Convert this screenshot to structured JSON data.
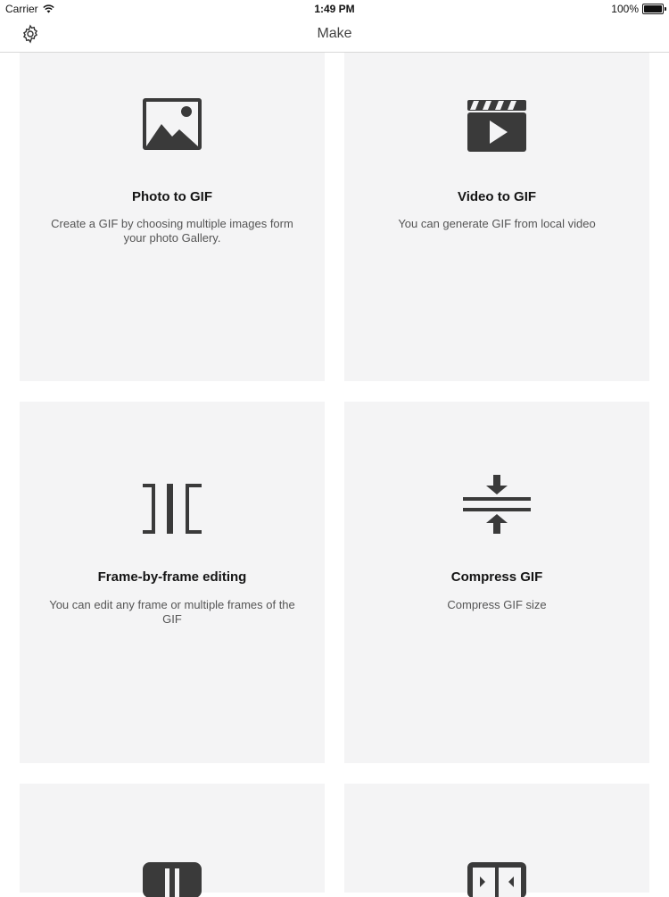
{
  "status_bar": {
    "carrier": "Carrier",
    "time": "1:49 PM",
    "battery": "100%",
    "wifi_icon": "wifi-icon",
    "battery_icon": "battery-icon"
  },
  "nav": {
    "title": "Make",
    "settings_icon": "gear-icon"
  },
  "cards": [
    {
      "icon": "photo-icon",
      "title": "Photo to GIF",
      "description": "Create a GIF by choosing multiple images form your photo Gallery."
    },
    {
      "icon": "video-clapper-icon",
      "title": "Video to GIF",
      "description": "You can generate GIF from local video"
    },
    {
      "icon": "frame-editing-icon",
      "title": "Frame-by-frame editing",
      "description": "You can edit any frame or multiple frames of the GIF"
    },
    {
      "icon": "compress-icon",
      "title": "Compress GIF",
      "description": "Compress GIF size"
    },
    {
      "icon": "columns-icon"
    },
    {
      "icon": "resize-icon"
    }
  ],
  "colors": {
    "card_background": "#f4f4f5",
    "icon_color": "#3a3a3a",
    "divider": "#d8d8d8"
  }
}
